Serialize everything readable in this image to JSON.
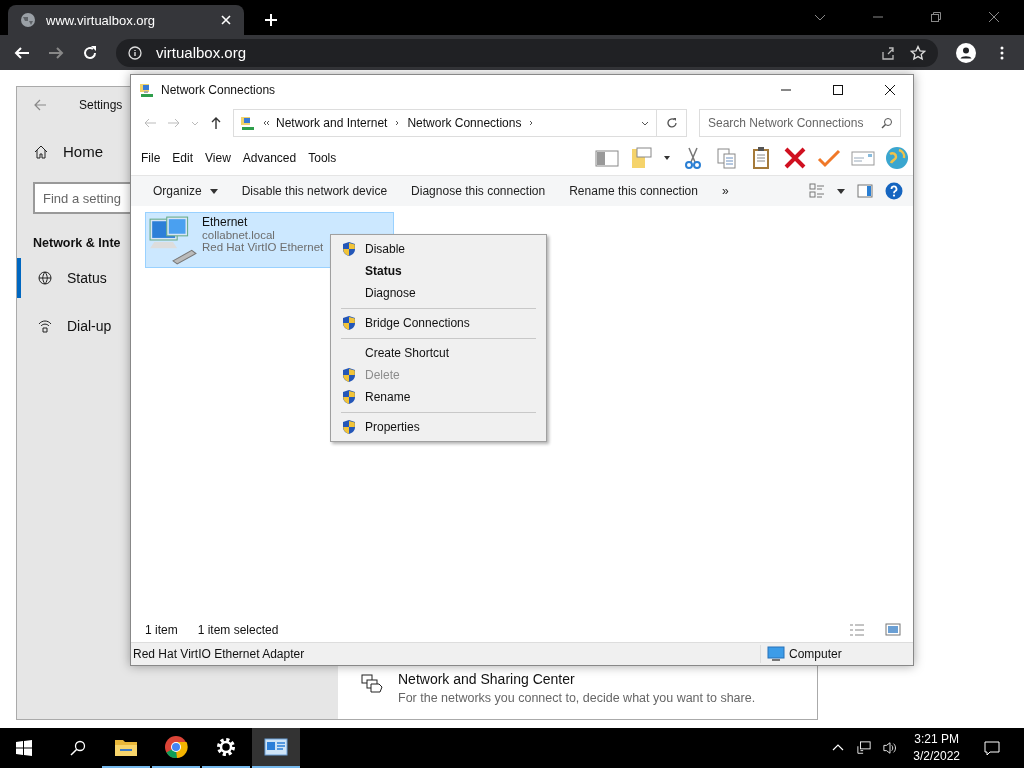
{
  "browser": {
    "tab_title": "www.virtualbox.org",
    "address": "virtualbox.org"
  },
  "settings": {
    "title": "Settings",
    "home": "Home",
    "search": {
      "placeholder": "Find a setting"
    },
    "section": "Network & Inte",
    "nav": [
      {
        "label": "Status",
        "kind": "globe",
        "selected": true
      },
      {
        "label": "Dial-up",
        "kind": "phone",
        "selected": false
      }
    ],
    "sharing_center": {
      "title": "Network and Sharing Center",
      "description": "For the networks you connect to, decide what you want to share."
    }
  },
  "explorer": {
    "title": "Network Connections",
    "breadcrumb": [
      "Network and Internet",
      "Network Connections"
    ],
    "search": {
      "placeholder": "Search Network Connections"
    },
    "menu": [
      "File",
      "Edit",
      "View",
      "Advanced",
      "Tools"
    ],
    "commands": [
      {
        "label": "Organize",
        "dropdown": true
      },
      {
        "label": "Disable this network device",
        "dropdown": false
      },
      {
        "label": "Diagnose this connection",
        "dropdown": false
      },
      {
        "label": "Rename this connection",
        "dropdown": false
      }
    ],
    "more": "»",
    "items": [
      {
        "name": "Ethernet",
        "domain": "collabnet.local",
        "adapter": "Red Hat VirtIO Ethernet",
        "selected": true
      }
    ],
    "status": {
      "count": "1 item",
      "selection": "1 item selected"
    },
    "details": {
      "adapter": "Red Hat VirtIO Ethernet Adapter",
      "zone": "Computer"
    }
  },
  "context_menu": [
    {
      "label": "Disable",
      "shield": true,
      "bold": false,
      "disabled": false,
      "separator_before": false
    },
    {
      "label": "Status",
      "shield": false,
      "bold": true,
      "disabled": false,
      "separator_before": false
    },
    {
      "label": "Diagnose",
      "shield": false,
      "bold": false,
      "disabled": false,
      "separator_before": false
    },
    {
      "label": "Bridge Connections",
      "shield": true,
      "bold": false,
      "disabled": false,
      "separator_before": true
    },
    {
      "label": "Create Shortcut",
      "shield": false,
      "bold": false,
      "disabled": false,
      "separator_before": true
    },
    {
      "label": "Delete",
      "shield": true,
      "bold": false,
      "disabled": true,
      "separator_before": false
    },
    {
      "label": "Rename",
      "shield": true,
      "bold": false,
      "disabled": false,
      "separator_before": false
    },
    {
      "label": "Properties",
      "shield": true,
      "bold": false,
      "disabled": false,
      "separator_before": true
    }
  ],
  "taskbar": {
    "apps": [
      {
        "kind": "folder",
        "running": true,
        "active": false
      },
      {
        "kind": "browser",
        "running": true,
        "active": false
      },
      {
        "kind": "gear",
        "running": true,
        "active": false
      },
      {
        "kind": "network",
        "running": true,
        "active": true
      }
    ],
    "time": "3:21 PM",
    "date": "3/2/2022"
  }
}
